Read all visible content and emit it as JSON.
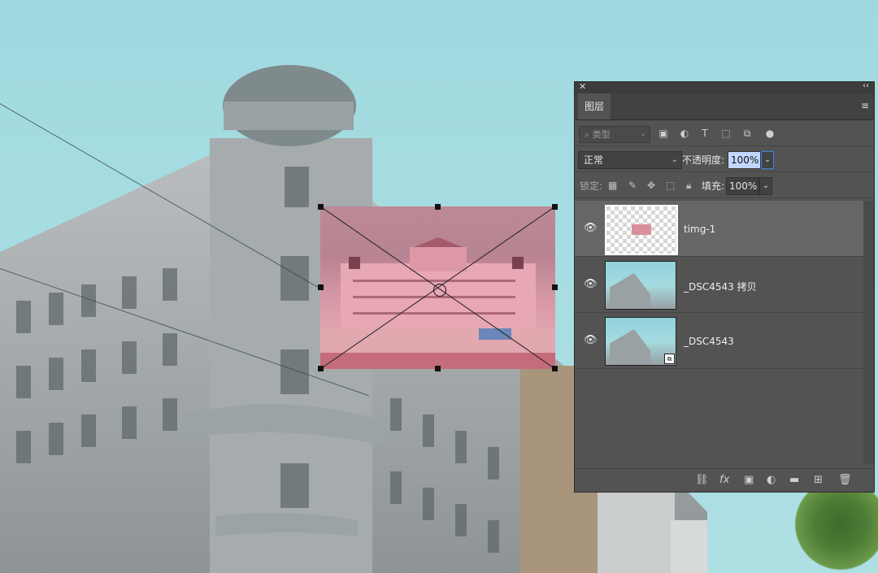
{
  "panel": {
    "title_tab": "图层",
    "close_glyph": "✕",
    "collapse_glyph": "‹‹",
    "menu_glyph": "≡",
    "filter_placeholder": "类型",
    "blend_mode": "正常",
    "opacity_label": "不透明度:",
    "opacity_value": "100%",
    "lock_label": "锁定:",
    "fill_label": "填充:",
    "fill_value": "100%"
  },
  "layers": [
    {
      "name": "timg-1",
      "visible": true,
      "selected": true
    },
    {
      "name": "_DSC4543 拷贝",
      "visible": true,
      "selected": false
    },
    {
      "name": "_DSC4543",
      "visible": true,
      "selected": false
    }
  ],
  "colors": {
    "panel_bg": "#535353",
    "selection": "#666666",
    "accent": "#3d82e8"
  }
}
